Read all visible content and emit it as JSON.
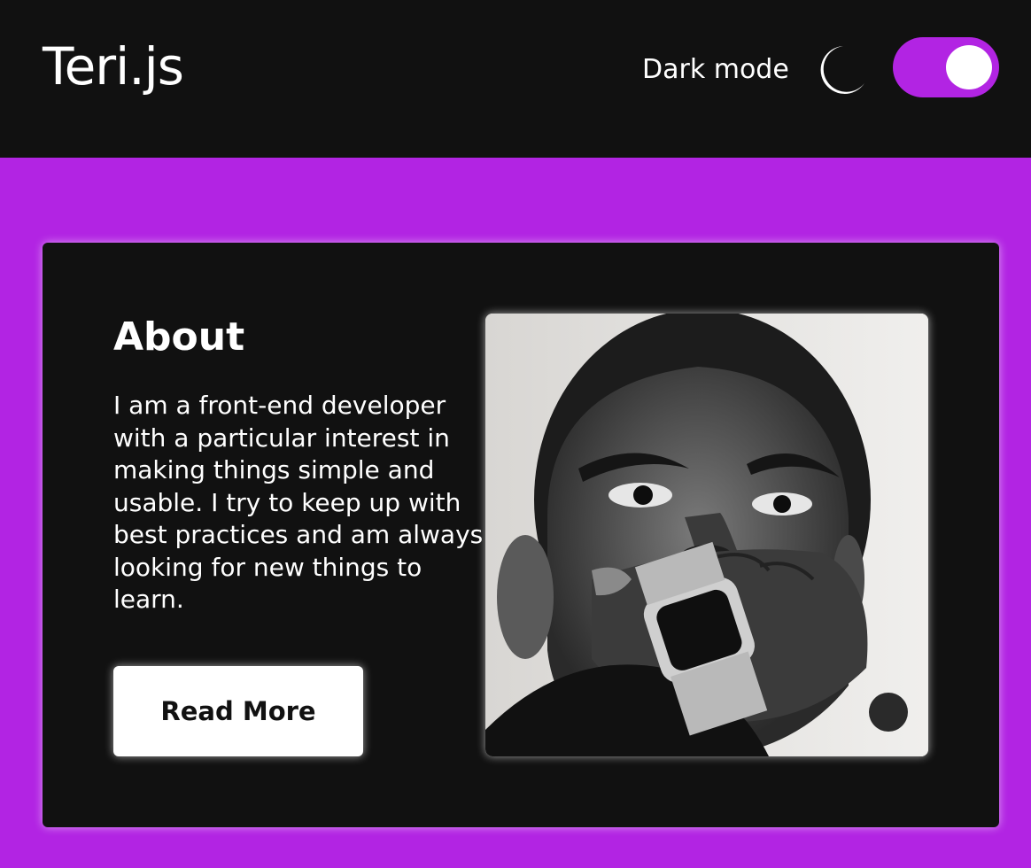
{
  "header": {
    "logo": "Teri.js",
    "dark_mode_label": "Dark mode",
    "moon_icon": "moon-icon",
    "toggle_on": true
  },
  "about": {
    "title": "About",
    "text": "I am a front-end developer with a particular interest in making things simple and usable. I try to keep up with best practices and am always looking for new things to learn.",
    "button_label": "Read More",
    "photo_alt": "Portrait photo"
  },
  "colors": {
    "accent": "#b224e3",
    "dark": "#111111",
    "light": "#ffffff"
  }
}
